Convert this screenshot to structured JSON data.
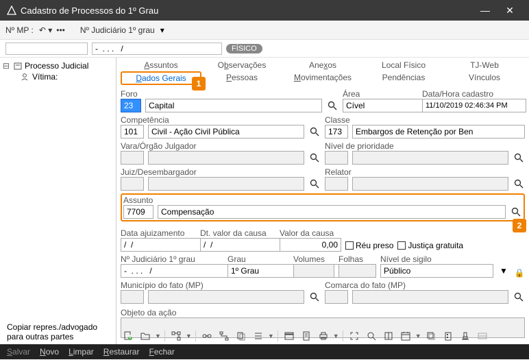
{
  "window": {
    "title": "Cadastro de Processos do 1º Grau"
  },
  "toprow": {
    "nmp_label": "Nº MP :",
    "njud_label": "Nº Judiciário  1º grau"
  },
  "secrow": {
    "nmp_value": "",
    "njud_value": "-  . . .   /",
    "badge": "FÍSICO"
  },
  "tree": {
    "root": "Processo Judicial",
    "child_label": "Vítima:",
    "child_value": ""
  },
  "copy_checkbox": "Copiar repres./advogado para outras partes",
  "tabs_row1": [
    "Assuntos",
    "Observações",
    "Anexos",
    "Local Físico",
    "TJ-Web"
  ],
  "tabs_row2": [
    "Dados Gerais",
    "Pessoas",
    "Movimentações",
    "Pendências",
    "Vínculos"
  ],
  "callouts": {
    "one": "1",
    "two": "2"
  },
  "form": {
    "foro_label": "Foro",
    "foro_code": "23",
    "foro_name": "Capital",
    "area_label": "Área",
    "area_value": "Cível",
    "datahora_label": "Data/Hora cadastro",
    "datahora_value": "11/10/2019 02:46:34 PM",
    "competencia_label": "Competência",
    "competencia_code": "101",
    "competencia_name": "Civil - Ação Civil Pública",
    "classe_label": "Classe",
    "classe_code": "173",
    "classe_name": "Embargos de Retenção por Ben",
    "vara_label": "Vara/Órgão Julgador",
    "nivel_label": "Nível de prioridade",
    "juiz_label": "Juiz/Desembargador",
    "relator_label": "Relator",
    "assunto_label": "Assunto",
    "assunto_code": "7709",
    "assunto_name": "Compensação",
    "data_ajuiz_label": "Data ajuizamento",
    "data_ajuiz_value": "/  /",
    "dtvalor_label": "Dt. valor da causa",
    "dtvalor_value": "/  /",
    "valor_label": "Valor da causa",
    "valor_value": "0,00",
    "reu_preso": "Réu preso",
    "justica_gratuita": "Justiça gratuita",
    "njud1_label": "Nº Judiciário  1º grau",
    "njud1_value": "-  . . .   /",
    "grau_label": "Grau",
    "grau_value": "1º Grau",
    "volumes_label": "Volumes",
    "folhas_label": "Folhas",
    "sigilo_label": "Nível de sigilo",
    "sigilo_value": "Público",
    "municipio_label": "Município do fato (MP)",
    "comarca_label": "Comarca do fato (MP)",
    "objeto_label": "Objeto da ação"
  },
  "status": {
    "salvar": "Salvar",
    "novo": "Novo",
    "limpar": "Limpar",
    "restaurar": "Restaurar",
    "fechar": "Fechar"
  }
}
